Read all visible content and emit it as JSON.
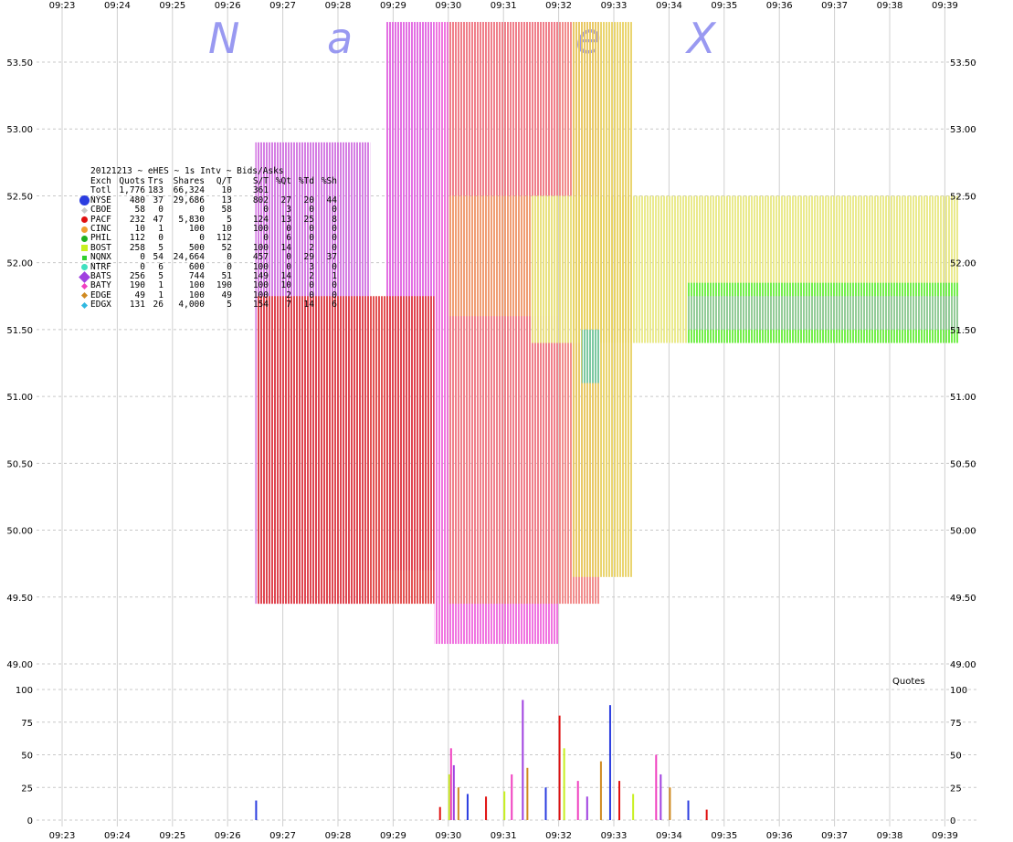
{
  "chart_data": {
    "type": "bar",
    "title": "20121213 ~ eHES ~ 1s Intv ~ Bids/Asks",
    "watermark_letters": [
      "N",
      "a",
      "e",
      "X"
    ],
    "x_ticks": [
      "09:23",
      "09:24",
      "09:25",
      "09:26",
      "09:27",
      "09:28",
      "09:29",
      "09:30",
      "09:31",
      "09:32",
      "09:33",
      "09:34",
      "09:35",
      "09:36",
      "09:37",
      "09:38",
      "09:39"
    ],
    "price_axis": {
      "ylim": [
        49.0,
        53.8
      ],
      "ticks": [
        "49.00",
        "49.50",
        "50.00",
        "50.50",
        "51.00",
        "51.50",
        "52.00",
        "52.50",
        "53.00",
        "53.50"
      ]
    },
    "volume_axis": {
      "label": "Quotes",
      "ylim": [
        0,
        100
      ],
      "ticks": [
        "0",
        "25",
        "50",
        "75",
        "100"
      ]
    },
    "legend_header": [
      "Exch",
      "Quots",
      "Trs",
      "Shares",
      "Q/T",
      "S/T",
      "%Qt",
      "%Td",
      "%Sh"
    ],
    "legend_rows": [
      {
        "exch": "Totl",
        "quots": "1,776",
        "trs": "183",
        "shares": "66,324",
        "qt": "10",
        "st": "361",
        "pqt": "",
        "ptd": "",
        "psh": "",
        "color": "",
        "marker": "none"
      },
      {
        "exch": "NYSE",
        "quots": "480",
        "trs": "37",
        "shares": "29,686",
        "qt": "13",
        "st": "802",
        "pqt": "27",
        "ptd": "20",
        "psh": "44",
        "color": "#2b3de0",
        "marker": "circle-lg"
      },
      {
        "exch": "CBOE",
        "quots": "58",
        "trs": "0",
        "shares": "0",
        "qt": "58",
        "st": "0",
        "pqt": "3",
        "ptd": "0",
        "psh": "0",
        "color": "#c8c8c8",
        "marker": "diamond"
      },
      {
        "exch": "PACF",
        "quots": "232",
        "trs": "47",
        "shares": "5,830",
        "qt": "5",
        "st": "124",
        "pqt": "13",
        "ptd": "25",
        "psh": "8",
        "color": "#e01010",
        "marker": "octagon"
      },
      {
        "exch": "CINC",
        "quots": "10",
        "trs": "1",
        "shares": "100",
        "qt": "10",
        "st": "100",
        "pqt": "0",
        "ptd": "0",
        "psh": "0",
        "color": "#f0a030",
        "marker": "circle"
      },
      {
        "exch": "PHIL",
        "quots": "112",
        "trs": "0",
        "shares": "0",
        "qt": "112",
        "st": "0",
        "pqt": "6",
        "ptd": "0",
        "psh": "0",
        "color": "#20b020",
        "marker": "circle"
      },
      {
        "exch": "BOST",
        "quots": "258",
        "trs": "5",
        "shares": "500",
        "qt": "52",
        "st": "100",
        "pqt": "14",
        "ptd": "2",
        "psh": "0",
        "color": "#c8f020",
        "marker": "square"
      },
      {
        "exch": "NQNX",
        "quots": "0",
        "trs": "54",
        "shares": "24,664",
        "qt": "0",
        "st": "457",
        "pqt": "0",
        "ptd": "29",
        "psh": "37",
        "color": "#30d030",
        "marker": "square-sm"
      },
      {
        "exch": "NTRF",
        "quots": "0",
        "trs": "6",
        "shares": "600",
        "qt": "0",
        "st": "100",
        "pqt": "0",
        "ptd": "3",
        "psh": "0",
        "color": "#40e0c0",
        "marker": "circle"
      },
      {
        "exch": "BATS",
        "quots": "256",
        "trs": "5",
        "shares": "744",
        "qt": "51",
        "st": "149",
        "pqt": "14",
        "ptd": "2",
        "psh": "1",
        "color": "#a040e0",
        "marker": "diamond-lg"
      },
      {
        "exch": "BATY",
        "quots": "190",
        "trs": "1",
        "shares": "100",
        "qt": "190",
        "st": "100",
        "pqt": "10",
        "ptd": "0",
        "psh": "0",
        "color": "#f040c0",
        "marker": "diamond"
      },
      {
        "exch": "EDGE",
        "quots": "49",
        "trs": "1",
        "shares": "100",
        "qt": "49",
        "st": "100",
        "pqt": "2",
        "ptd": "0",
        "psh": "0",
        "color": "#d08a20",
        "marker": "diamond"
      },
      {
        "exch": "EDGX",
        "quots": "131",
        "trs": "26",
        "shares": "4,000",
        "qt": "5",
        "st": "154",
        "pqt": "7",
        "ptd": "14",
        "psh": "6",
        "color": "#30b8e0",
        "marker": "diamond"
      }
    ],
    "quote_bands": [
      {
        "exch": "BATS",
        "t0": "09:26:30",
        "t1": "09:28:35",
        "bid": 49.45,
        "ask": 52.9,
        "color": "#d070e0"
      },
      {
        "exch": "BATY",
        "t0": "09:28:52",
        "t1": "09:29:45",
        "bid": 49.7,
        "ask": 53.8,
        "color": "#e060e0"
      },
      {
        "exch": "PACF",
        "t0": "09:26:32",
        "t1": "09:29:45",
        "bid": 49.45,
        "ask": 51.75,
        "color": "#e04040"
      },
      {
        "exch": "BATY",
        "t0": "09:29:45",
        "t1": "09:32:00",
        "bid": 49.15,
        "ask": 53.8,
        "color": "#ee66dd"
      },
      {
        "exch": "PACF",
        "t0": "09:30:00",
        "t1": "09:32:45",
        "bid": 49.45,
        "ask": 53.8,
        "color": "#f08080"
      },
      {
        "exch": "PACF",
        "t0": "09:30:00",
        "t1": "09:32:00",
        "bid": 51.6,
        "ask": 52.5,
        "color": "#f0a070"
      },
      {
        "exch": "BOST",
        "t0": "09:31:30",
        "t1": "09:39:15",
        "bid": 51.4,
        "ask": 52.5,
        "color": "#e8e880"
      },
      {
        "exch": "EDGE",
        "t0": "09:32:15",
        "t1": "09:33:20",
        "bid": 49.65,
        "ask": 53.8,
        "color": "#e8d060"
      },
      {
        "exch": "NQNX",
        "t0": "09:34:20",
        "t1": "09:39:15",
        "bid": 51.4,
        "ask": 51.85,
        "color": "#66ee44"
      },
      {
        "exch": "NTRF",
        "t0": "09:34:20",
        "t1": "09:39:15",
        "bid": 51.5,
        "ask": 51.75,
        "color": "#98c8a0"
      },
      {
        "exch": "EDGX",
        "t0": "09:32:25",
        "t1": "09:32:45",
        "bid": 51.1,
        "ask": 51.5,
        "color": "#70c8a8"
      }
    ],
    "volume_spikes": [
      {
        "t": "09:26:30",
        "v": 15
      },
      {
        "t": "09:29:50",
        "v": 10
      },
      {
        "t": "09:30:00",
        "v": 35
      },
      {
        "t": "09:30:02",
        "v": 55
      },
      {
        "t": "09:30:05",
        "v": 42
      },
      {
        "t": "09:30:10",
        "v": 25
      },
      {
        "t": "09:30:20",
        "v": 20
      },
      {
        "t": "09:30:40",
        "v": 18
      },
      {
        "t": "09:31:00",
        "v": 22
      },
      {
        "t": "09:31:08",
        "v": 35
      },
      {
        "t": "09:31:20",
        "v": 92
      },
      {
        "t": "09:31:25",
        "v": 40
      },
      {
        "t": "09:31:45",
        "v": 25
      },
      {
        "t": "09:32:00",
        "v": 80
      },
      {
        "t": "09:32:05",
        "v": 55
      },
      {
        "t": "09:32:20",
        "v": 30
      },
      {
        "t": "09:32:30",
        "v": 18
      },
      {
        "t": "09:32:45",
        "v": 45
      },
      {
        "t": "09:32:55",
        "v": 88
      },
      {
        "t": "09:33:05",
        "v": 30
      },
      {
        "t": "09:33:20",
        "v": 20
      },
      {
        "t": "09:33:45",
        "v": 50
      },
      {
        "t": "09:33:50",
        "v": 35
      },
      {
        "t": "09:34:00",
        "v": 25
      },
      {
        "t": "09:34:20",
        "v": 15
      },
      {
        "t": "09:34:40",
        "v": 8
      }
    ],
    "grid": true
  }
}
